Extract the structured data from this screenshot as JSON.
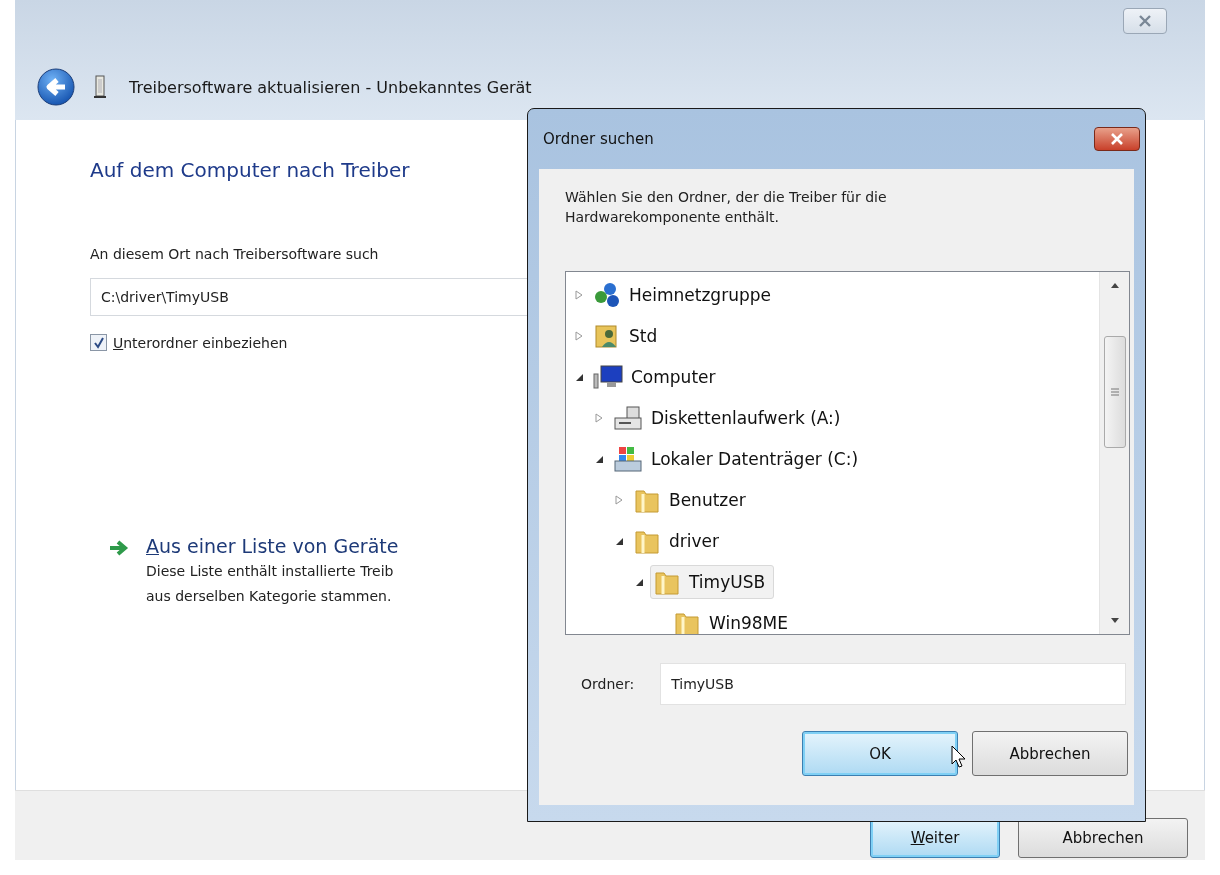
{
  "window": {
    "title": "Treibersoftware aktualisieren - Unbekanntes Gerät"
  },
  "page": {
    "heading": "Auf dem Computer nach Treiber",
    "location_label": "An diesem Ort nach Treibersoftware such",
    "location_value": "C:\\driver\\TimyUSB",
    "include_subfolders": {
      "label": "Unterordner einbeziehen",
      "checked": true
    },
    "list_link": "Aus einer Liste von Geräte",
    "list_description": "Diese Liste enthält installierte Treib\naus derselben Kategorie stammen."
  },
  "footer_buttons": [
    {
      "label": "Weiter",
      "default": true
    },
    {
      "label": "Abbrechen",
      "default": false
    }
  ],
  "dialog": {
    "title": "Ordner suchen",
    "instruction": "Wählen Sie den Ordner, der die Treiber für die Hardwarekomponente enthält.",
    "tree": [
      {
        "label": "Heimnetzgruppe",
        "kind": "network",
        "expanded": false,
        "selected": false
      },
      {
        "label": "Std",
        "kind": "user",
        "expanded": false,
        "selected": false
      },
      {
        "label": "Computer",
        "kind": "computer",
        "expanded": true,
        "selected": false,
        "children": [
          {
            "label": "Diskettenlaufwerk (A:)",
            "kind": "floppy",
            "expanded": false,
            "selected": false
          },
          {
            "label": "Lokaler Datenträger (C:)",
            "kind": "drive",
            "expanded": true,
            "selected": false,
            "children": [
              {
                "label": "Benutzer",
                "kind": "folder",
                "expanded": false,
                "selected": false
              },
              {
                "label": "driver",
                "kind": "folder",
                "expanded": true,
                "selected": false,
                "children": [
                  {
                    "label": "TimyUSB",
                    "kind": "folder",
                    "expanded": true,
                    "selected": true,
                    "children": [
                      {
                        "label": "Win98ME",
                        "kind": "folder",
                        "selected": false
                      }
                    ]
                  }
                ]
              }
            ]
          }
        ]
      }
    ],
    "folder_label": "Ordner:",
    "folder_value": "TimyUSB",
    "buttons": [
      {
        "label": "OK",
        "default": true
      },
      {
        "label": "Abbrechen",
        "default": false
      }
    ]
  }
}
